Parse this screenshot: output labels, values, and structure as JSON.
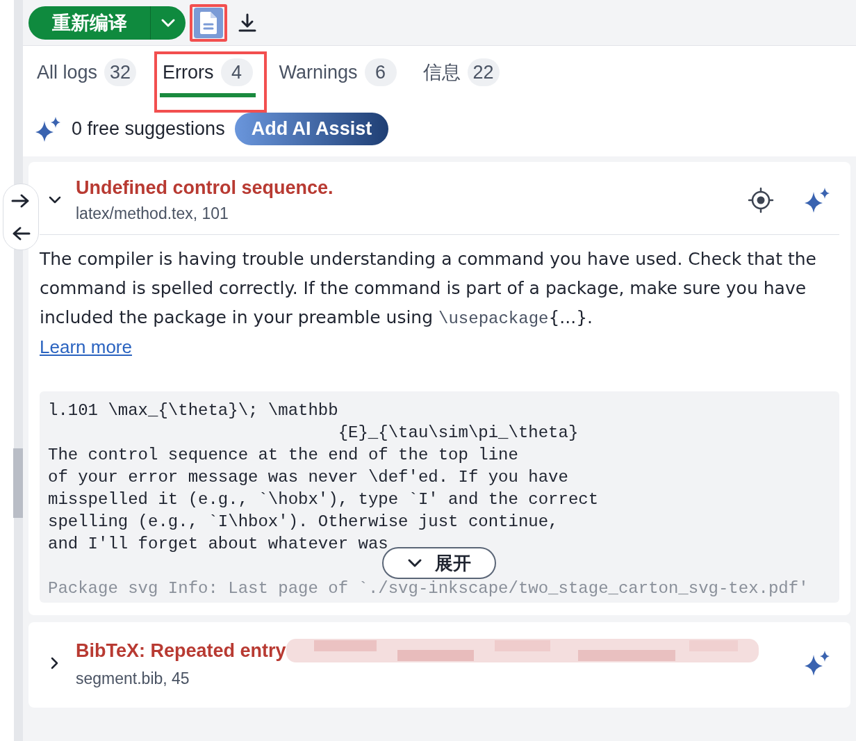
{
  "toolbar": {
    "recompile_label": "重新编译",
    "document_button": {
      "highlighted": true
    }
  },
  "tabs": [
    {
      "label": "All logs",
      "count": "32",
      "selected": false,
      "highlighted": false
    },
    {
      "label": "Errors",
      "count": "4",
      "selected": true,
      "highlighted": true
    },
    {
      "label": "Warnings",
      "count": "6",
      "selected": false,
      "highlighted": false
    },
    {
      "label": "信息",
      "count": "22",
      "selected": false,
      "highlighted": false
    }
  ],
  "suggestions": {
    "text": "0 free suggestions",
    "button": "Add AI Assist"
  },
  "entries": [
    {
      "title": "Undefined control sequence.",
      "location": "latex/method.tex, 101",
      "expanded": true,
      "show_locate": true,
      "redacted": false,
      "description": {
        "before": "The compiler is having trouble understanding a command you have used. Check that the command is spelled correctly. If the command is part of a package, make sure you have included the package in your preamble using ",
        "code": "\\usepackage",
        "after": "{...}."
      },
      "learn_more": "Learn more",
      "log": [
        {
          "text": "l.101 \\max_{\\theta}\\; \\mathbb",
          "kind": "line"
        },
        {
          "text": "{E}_{\\tau\\sim\\pi_\\theta}",
          "kind": "continuation"
        },
        {
          "text": "The control sequence at the end of the top line",
          "kind": "line"
        },
        {
          "text": "of your error message was never \\def'ed. If you have",
          "kind": "line"
        },
        {
          "text": "misspelled it (e.g., `\\hobx'), type `I' and the correct",
          "kind": "line"
        },
        {
          "text": "spelling (e.g., `I\\hbox'). Otherwise just continue,",
          "kind": "line"
        },
        {
          "text": "and I'll forget about whatever was",
          "kind": "line"
        },
        {
          "text": "Package svg Info: Last page of `./svg-inkscape/two_stage_carton_svg-tex.pdf'",
          "kind": "faded"
        }
      ],
      "expand_label": "展开"
    },
    {
      "title": "BibTeX: Repeated entry",
      "location": "segment.bib, 45",
      "expanded": false,
      "show_locate": false,
      "redacted": true
    }
  ]
}
